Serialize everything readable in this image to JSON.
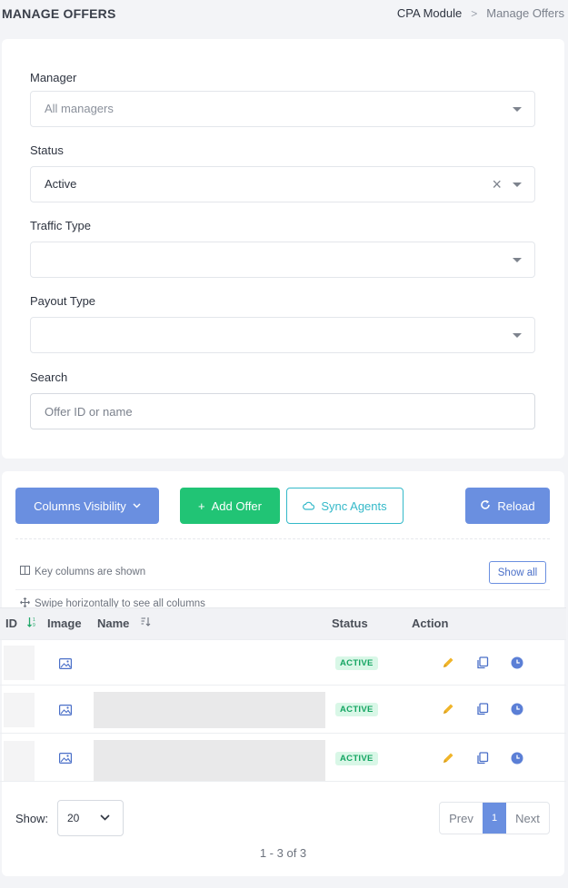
{
  "header": {
    "title": "MANAGE OFFERS",
    "breadcrumb": [
      "CPA Module",
      "Manage Offers"
    ]
  },
  "filters": {
    "manager": {
      "label": "Manager",
      "value": "All managers"
    },
    "status": {
      "label": "Status",
      "value": "Active"
    },
    "traffic_type": {
      "label": "Traffic Type",
      "value": ""
    },
    "payout_type": {
      "label": "Payout Type",
      "value": ""
    },
    "search": {
      "label": "Search",
      "placeholder": "Offer ID or name"
    }
  },
  "toolbar": {
    "columns_visibility": "Columns Visibility",
    "add_offer": "Add Offer",
    "sync_agents": "Sync Agents",
    "reload": "Reload"
  },
  "hints": {
    "key_columns": "Key columns are shown",
    "swipe": "Swipe horizontally to see all columns",
    "show_all": "Show all"
  },
  "table": {
    "columns": [
      "ID",
      "Image",
      "Name",
      "Status",
      "Action"
    ],
    "rows": [
      {
        "status": "ACTIVE"
      },
      {
        "status": "ACTIVE"
      },
      {
        "status": "ACTIVE"
      }
    ]
  },
  "footer": {
    "show_label": "Show:",
    "page_size": "20",
    "prev": "Prev",
    "page": "1",
    "next": "Next",
    "range": "1 - 3 of 3"
  },
  "colors": {
    "primary": "#6a8fe0",
    "success": "#21c475",
    "info": "#34b9c9",
    "edit": "#f0b429"
  }
}
